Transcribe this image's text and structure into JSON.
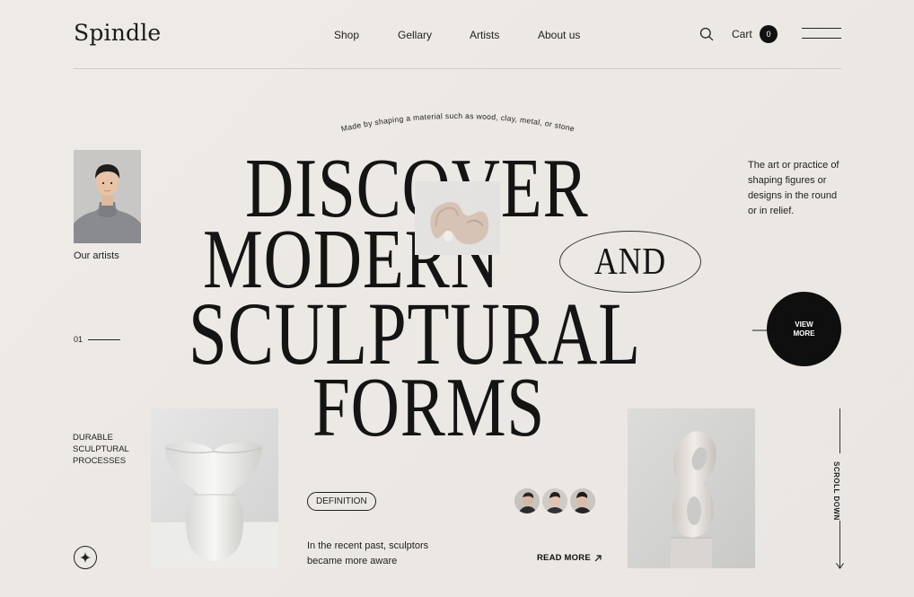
{
  "header": {
    "logo": "Spindle",
    "nav": [
      "Shop",
      "Gellary",
      "Artists",
      "About us"
    ],
    "cart_label": "Cart",
    "cart_count": "0"
  },
  "hero": {
    "curved_caption": "Made by shaping a material such as wood, clay, metal, or stone",
    "heading_line1": "DISCOVER",
    "heading_line2": "MODERN",
    "heading_and": "AND",
    "heading_line3": "SCULPTURAL",
    "heading_line4": "FORMS"
  },
  "left": {
    "artists_label": "Our artists",
    "counter": "01",
    "durable": "DURABLE SCULPTURAL PROCESSES"
  },
  "right": {
    "description": "The art or practice of shaping figures or designs in the round or in relief.",
    "view_more_line1": "VIEW",
    "view_more_line2": "MORE",
    "scroll_down": "SCROLL DOWN"
  },
  "bottom": {
    "definition_pill": "DEFINITION",
    "recent_text": "In the recent past, sculptors became more aware",
    "read_more": "READ MORE"
  },
  "colors": {
    "background": "#ece8e4",
    "ink": "#141414",
    "accent_dark": "#0f0f0f"
  },
  "icons": {
    "search": "search-icon",
    "menu": "hamburger-menu-icon",
    "star": "sparkle-star-icon",
    "arrow_up_right": "arrow-up-right-icon",
    "arrow_right": "arrow-right-icon",
    "arrow_down": "arrow-down-icon"
  }
}
